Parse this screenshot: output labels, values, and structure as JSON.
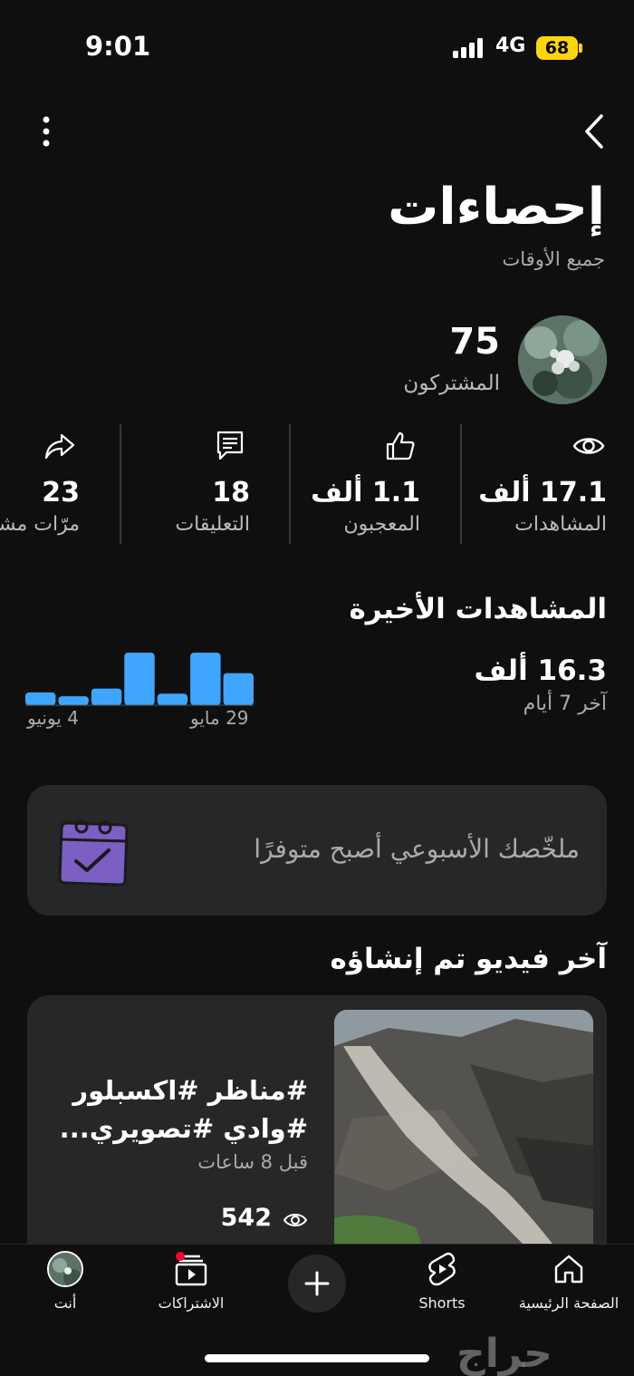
{
  "status_bar": {
    "time": "9:01",
    "network": "4G",
    "battery": "68"
  },
  "header": {
    "title": "إحصاءات",
    "subtitle": "جميع الأوقات"
  },
  "subscribers": {
    "count": "75",
    "label": "المشتركون"
  },
  "stats": [
    {
      "icon": "eye-icon",
      "value": "17.1 ألف",
      "label": "المشاهدات"
    },
    {
      "icon": "thumbs-up-icon",
      "value": "1.1 ألف",
      "label": "المعجبون"
    },
    {
      "icon": "comment-icon",
      "value": "18",
      "label": "التعليقات"
    },
    {
      "icon": "share-icon",
      "value": "23",
      "label": "مرّات مشا"
    }
  ],
  "recent_views": {
    "title": "المشاهدات الأخيرة",
    "value": "16.3 ألف",
    "period": "آخر 7 أيام",
    "axis_start": "29 مايو",
    "axis_end": "4 يونيو"
  },
  "chart_data": {
    "type": "bar",
    "categories": [
      "29 مايو",
      "",
      "",
      "",
      "",
      "",
      "4 يونيو"
    ],
    "values": [
      0.5,
      0.82,
      0.18,
      0.82,
      0.26,
      0.14,
      0.2
    ],
    "color": "#3ea6ff"
  },
  "summary": {
    "text": "ملخّصك الأسبوعي أصبح متوفرًا"
  },
  "latest_video": {
    "section_title": "آخر فيديو تم إنشاؤه",
    "title_line1": "#مناظر #اكسبلور",
    "title_line2": "#وادي #تصويري...",
    "age": "قبل 8 ساعات",
    "views": "542"
  },
  "bottom_nav": {
    "home": "الصفحة الرئيسية",
    "shorts": "Shorts",
    "subscriptions": "الاشتراكات",
    "you": "أنت"
  },
  "watermark": "حراج"
}
